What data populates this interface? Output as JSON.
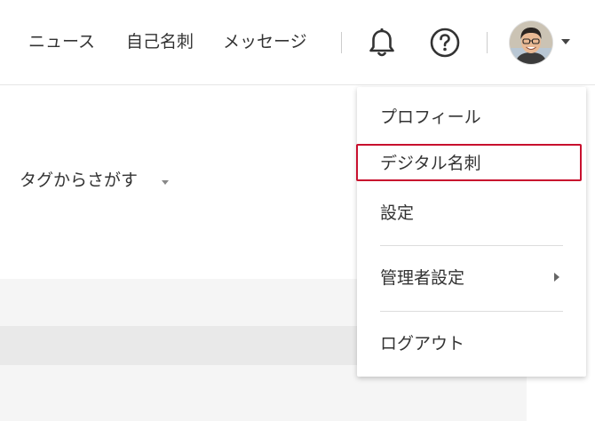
{
  "header": {
    "nav": {
      "news": "ニュース",
      "business_card": "自己名刺",
      "messages": "メッセージ"
    },
    "icons": {
      "notifications": "bell-icon",
      "help": "question-circle-icon",
      "account_menu": "chevron-down-icon"
    }
  },
  "filter": {
    "tag_search_label": "タグからさがす"
  },
  "user_menu": {
    "items": [
      {
        "label": "プロフィール"
      },
      {
        "label": "デジタル名刺"
      },
      {
        "label": "設定"
      },
      {
        "label": "管理者設定"
      },
      {
        "label": "ログアウト"
      }
    ]
  },
  "colors": {
    "highlight": "#c8102e",
    "text": "#333333",
    "background": "#f5f5f5"
  }
}
